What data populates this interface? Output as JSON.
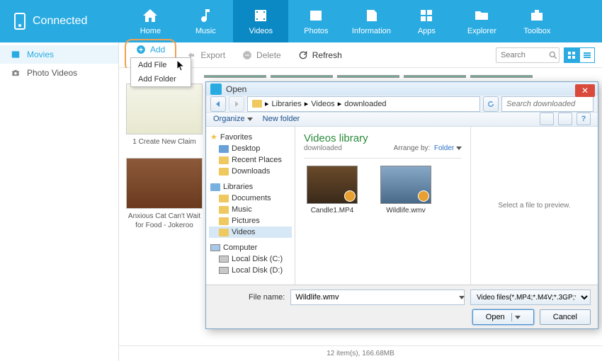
{
  "device": {
    "status": "Connected"
  },
  "nav": [
    {
      "id": "home",
      "label": "Home"
    },
    {
      "id": "music",
      "label": "Music"
    },
    {
      "id": "videos",
      "label": "Videos"
    },
    {
      "id": "photos",
      "label": "Photos"
    },
    {
      "id": "information",
      "label": "Information"
    },
    {
      "id": "apps",
      "label": "Apps"
    },
    {
      "id": "explorer",
      "label": "Explorer"
    },
    {
      "id": "toolbox",
      "label": "Toolbox"
    }
  ],
  "sidebar": {
    "items": [
      {
        "label": "Movies"
      },
      {
        "label": "Photo Videos"
      }
    ]
  },
  "toolbar": {
    "add": "Add",
    "export": "Export",
    "delete": "Delete",
    "refresh": "Refresh",
    "search_placeholder": "Search"
  },
  "add_menu": {
    "file": "Add File",
    "folder": "Add Folder"
  },
  "thumbs": [
    {
      "caption": "1 Create New Claim"
    },
    {
      "caption": "Anxious Cat Can't Wait for Food - Jokeroo"
    }
  ],
  "status": "12 item(s), 166.68MB",
  "dialog": {
    "title": "Open",
    "breadcrumb": [
      "Libraries",
      "Videos",
      "downloaded"
    ],
    "search_placeholder": "Search downloaded",
    "organize": "Organize",
    "new_folder": "New folder",
    "library_title": "Videos library",
    "library_sub": "downloaded",
    "arrange_label": "Arrange by:",
    "arrange_value": "Folder",
    "tree": {
      "favorites": "Favorites",
      "desktop": "Desktop",
      "recent": "Recent Places",
      "downloads": "Downloads",
      "libraries": "Libraries",
      "documents": "Documents",
      "music": "Music",
      "pictures": "Pictures",
      "videos": "Videos",
      "computer": "Computer",
      "disk_c": "Local Disk (C:)",
      "disk_d": "Local Disk (D:)"
    },
    "files": [
      {
        "name": "Candle1.MP4"
      },
      {
        "name": "Wildlife.wmv"
      }
    ],
    "preview_text": "Select a file to preview.",
    "filename_label": "File name:",
    "filename_value": "Wildlife.wmv",
    "filter": "Video files(*.MP4;*.M4V;*.3GP;*",
    "open": "Open",
    "cancel": "Cancel"
  }
}
